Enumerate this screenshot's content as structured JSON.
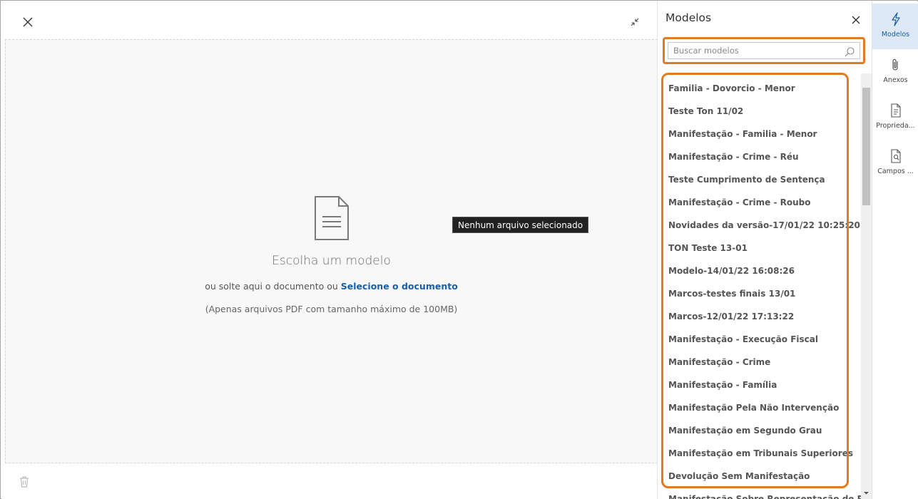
{
  "dropzone": {
    "title": "Escolha um modelo",
    "drop_text": "ou solte aqui o documento ou",
    "select_link": "Selecione o documento",
    "hint": "(Apenas arquivos PDF com tamanho máximo de 100MB)",
    "tooltip": "Nenhum arquivo selecionado"
  },
  "panel": {
    "title": "Modelos",
    "search_placeholder": "Buscar modelos",
    "items": [
      "Familia - Dovorcio - Menor",
      "Teste Ton 11/02",
      "Manifestação - Familia - Menor",
      "Manifestação - Crime - Réu",
      "Teste Cumprimento de Sentença",
      "Manifestação - Crime - Roubo",
      "Novidades da versão-17/01/22 10:25:20",
      "TON Teste 13-01",
      "Modelo-14/01/22 16:08:26",
      "Marcos-testes finais 13/01",
      "Marcos-12/01/22 17:13:22",
      "Manifestação - Execução Fiscal",
      "Manifestação - Crime",
      "Manifestação - Família",
      "Manifestação Pela Não Intervenção",
      "Manifestação em Segundo Grau",
      "Manifestação em Tribunais Superiores",
      "Devolução Sem Manifestação",
      "Manifestação Sobre Representação de Prisão"
    ]
  },
  "rail": {
    "items": [
      {
        "label": "Modelos",
        "icon": "lightning-icon",
        "active": true
      },
      {
        "label": "Anexos",
        "icon": "paperclip-icon",
        "active": false
      },
      {
        "label": "Proprieda...",
        "icon": "document-properties-icon",
        "active": false
      },
      {
        "label": "Campos ...",
        "icon": "document-search-icon",
        "active": false
      }
    ]
  },
  "colors": {
    "highlight": "#e07b24",
    "link": "#1a5ea8",
    "rail_active_bg": "#dde9f7"
  }
}
